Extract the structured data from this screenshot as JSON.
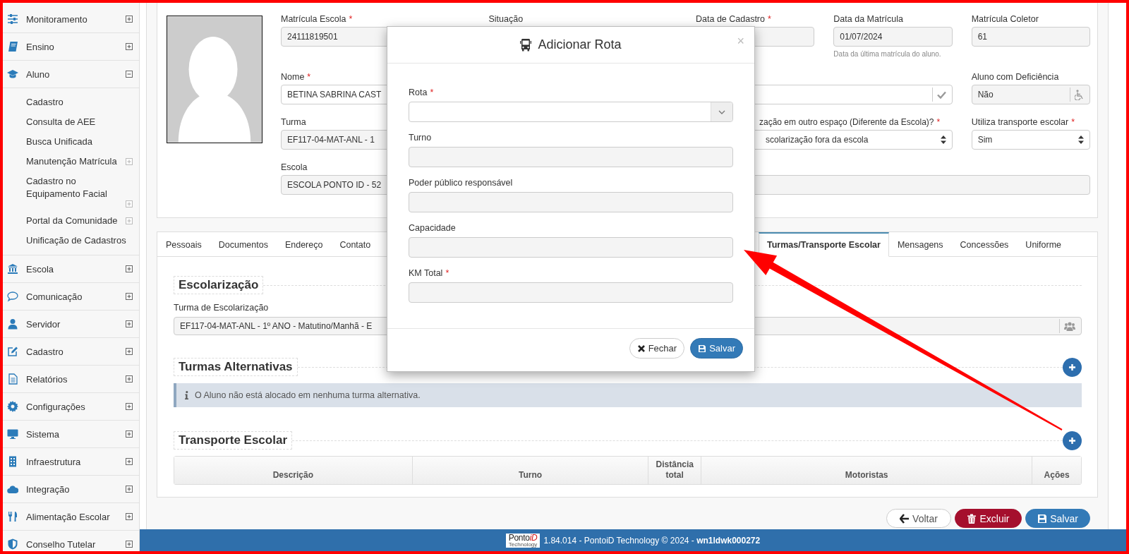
{
  "sidebar": {
    "items": [
      {
        "label": "Monitoramento",
        "expanded": false
      },
      {
        "label": "Ensino",
        "expanded": false
      },
      {
        "label": "Aluno",
        "expanded": true,
        "children": [
          {
            "label": "Cadastro",
            "kind": "link"
          },
          {
            "label": "Consulta de AEE",
            "kind": "link"
          },
          {
            "label": "Busca Unificada",
            "kind": "link"
          },
          {
            "label": "Manutenção Matrícula",
            "kind": "group",
            "expanded": false
          },
          {
            "label": "Cadastro no Equipamento Facial",
            "kind": "group",
            "expanded": false
          },
          {
            "label": "Portal da Comunidade",
            "kind": "group",
            "expanded": false
          },
          {
            "label": "Unificação de Cadastros",
            "kind": "link"
          }
        ]
      },
      {
        "label": "Escola",
        "expanded": false
      },
      {
        "label": "Comunicação",
        "expanded": false
      },
      {
        "label": "Servidor",
        "expanded": false
      },
      {
        "label": "Cadastro",
        "expanded": false
      },
      {
        "label": "Relatórios",
        "expanded": false
      },
      {
        "label": "Configurações",
        "expanded": false
      },
      {
        "label": "Sistema",
        "expanded": false
      },
      {
        "label": "Infraestrutura",
        "expanded": false
      },
      {
        "label": "Integração",
        "expanded": false
      },
      {
        "label": "Alimentação Escolar",
        "expanded": false
      },
      {
        "label": "Conselho Tutelar",
        "expanded": false
      }
    ]
  },
  "student_form": {
    "fields": [
      {
        "label": "Matrícula Escola",
        "required_mark": "*",
        "value": "24111819501",
        "kind": "readonly"
      },
      {
        "label": "Situação",
        "kind": "readonly"
      },
      {
        "label": "Data de Cadastro",
        "required_mark": "*",
        "kind": "readonly"
      },
      {
        "label": "Data da Matrícula",
        "value": "01/07/2024",
        "hint": "Data da última matrícula do aluno.",
        "kind": "readonly"
      },
      {
        "label": "Matrícula Coletor",
        "value": "61",
        "kind": "readonly"
      },
      {
        "label": "Nome",
        "required_mark": "*",
        "value": "BETINA SABRINA CAST",
        "kind": "text"
      },
      {
        "kind": "check"
      },
      {
        "label": "Aluno com Deficiência",
        "value": "Não",
        "kind": "accessibility"
      },
      {
        "label": "Turma",
        "value": "EF117-04-MAT-ANL - 1",
        "kind": "readonly"
      },
      {
        "label": "zação em outro espaço (Diferente da Escola)?",
        "required_mark": "*",
        "value": "scolarização fora da escola",
        "kind": "select"
      },
      {
        "label": "Utiliza transporte escolar",
        "required_mark": "*",
        "value": "Sim",
        "kind": "select"
      },
      {
        "label": "Escola",
        "value": "ESCOLA PONTO ID - 52",
        "kind": "readonly"
      },
      {
        "kind": "readonly"
      }
    ]
  },
  "tabs": [
    {
      "label": "Pessoais",
      "selected": false
    },
    {
      "label": "Documentos",
      "selected": false
    },
    {
      "label": "Endereço",
      "selected": false
    },
    {
      "label": "Contato",
      "selected": false
    },
    {
      "label": "Turmas/Transporte Escolar",
      "selected": true
    },
    {
      "label": "Mensagens",
      "selected": false
    },
    {
      "label": "Concessões",
      "selected": false
    },
    {
      "label": "Uniforme",
      "selected": false
    }
  ],
  "schooling": {
    "title": "Escolarização",
    "field_label": "Turma de Escolarização",
    "field_value": "EF117-04-MAT-ANL - 1º ANO - Matutino/Manhã - E"
  },
  "alternative_classes": {
    "title": "Turmas Alternativas",
    "info": "O Aluno não está alocado em nenhuma turma alternativa."
  },
  "school_transport": {
    "title": "Transporte Escolar",
    "columns": [
      "Descrição",
      "Turno",
      "Distância total",
      "Motoristas",
      "Ações"
    ]
  },
  "actions": [
    {
      "label": "Voltar",
      "kind": "back"
    },
    {
      "label": "Excluir",
      "kind": "delete"
    },
    {
      "label": "Salvar",
      "kind": "save"
    }
  ],
  "footer": {
    "logo": "Ponto",
    "logo_accent": "iD",
    "logo_caption": "Technology",
    "text": "1.84.014 - PontoiD Technology © 2024 - **wn1ldwk000272**"
  },
  "modal": {
    "title": "Adicionar Rota",
    "close": "×",
    "fields": [
      {
        "label": "Rota",
        "required_mark": "*",
        "kind": "dropdown"
      },
      {
        "label": "Turno",
        "kind": "readonly"
      },
      {
        "label": "Poder público responsável",
        "kind": "readonly"
      },
      {
        "label": "Capacidade",
        "kind": "readonly"
      },
      {
        "label": "KM Total",
        "required_mark": "*",
        "kind": "readonly"
      }
    ],
    "buttons": [
      {
        "label": "Fechar",
        "kind": "close"
      },
      {
        "label": "Salvar",
        "kind": "save"
      }
    ]
  }
}
